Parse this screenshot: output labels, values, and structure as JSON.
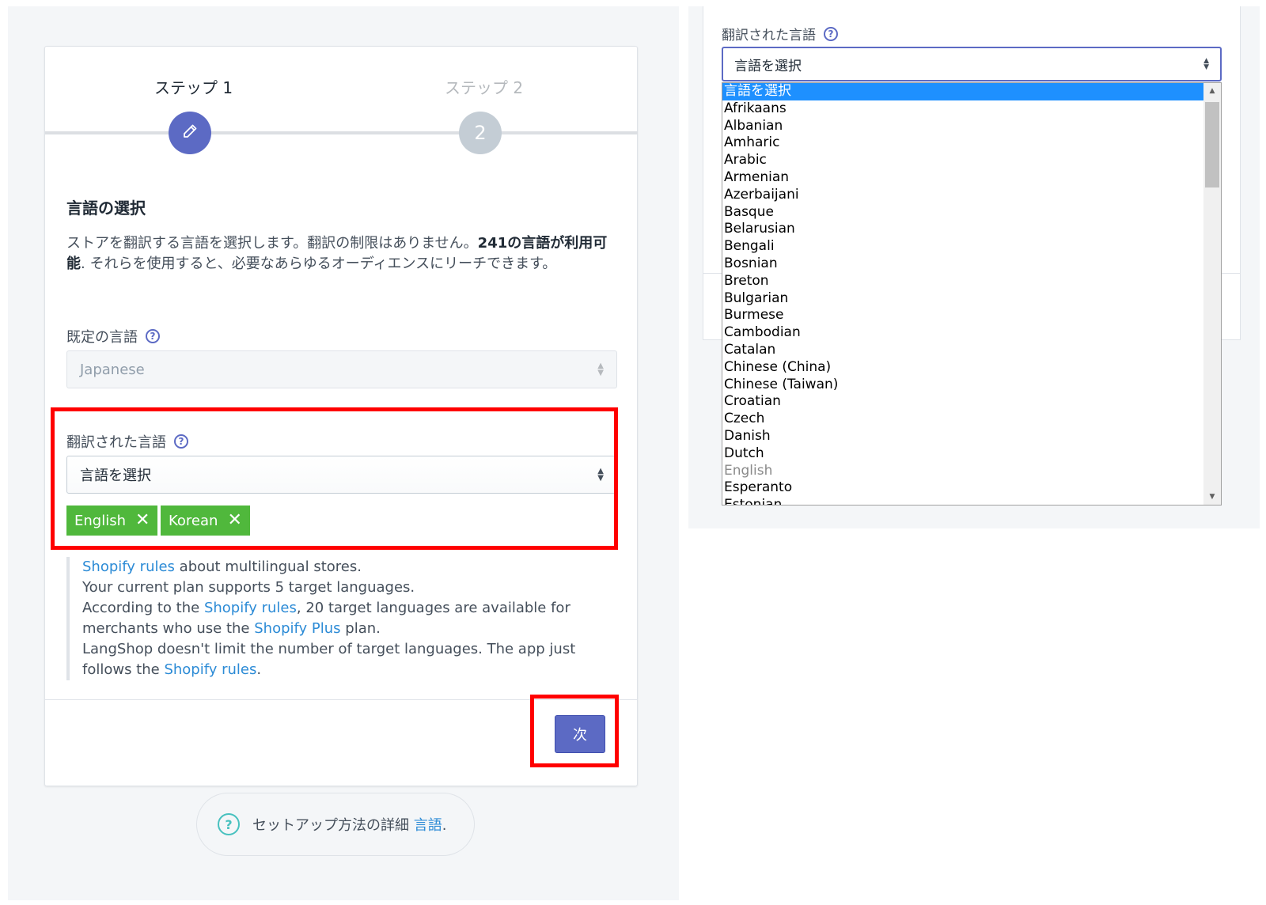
{
  "steps": [
    {
      "label": "ステップ 1",
      "state": "active",
      "icon": "pencil-icon"
    },
    {
      "label": "ステップ 2",
      "state": "inactive",
      "number": "2"
    }
  ],
  "section": {
    "title": "言語の選択",
    "desc_pre": "ストアを翻訳する言語を選択します。翻訳の制限はありません。",
    "desc_bold": "241の言語が利用可能",
    "desc_post": ". それらを使用すると、必要なあらゆるオーディエンスにリーチできます。"
  },
  "default_language": {
    "label": "既定の言語",
    "value": "Japanese"
  },
  "translated_language": {
    "label": "翻訳された言語",
    "placeholder": "言語を選択",
    "tags": [
      "English",
      "Korean"
    ]
  },
  "notes": {
    "line1_link": "Shopify rules",
    "line1_text": " about multilingual stores.",
    "line2": "Your current plan supports 5 target languages.",
    "line3_pre": "According to the ",
    "line3_link": "Shopify rules",
    "line3_mid": ", 20 target languages are available for merchants who use the ",
    "line3_link2": "Shopify Plus",
    "line3_post": " plan.",
    "line4_pre": "LangShop doesn't limit the number of target languages. The app just follows the ",
    "line4_link": "Shopify rules",
    "line4_post": "."
  },
  "next_button": "次",
  "footer_help": {
    "text": "セットアップ方法の詳細 ",
    "link": "言語",
    "post": "."
  },
  "dropdown": {
    "label": "翻訳された言語",
    "placeholder": "言語を選択",
    "options": [
      "言語を選択",
      "Afrikaans",
      "Albanian",
      "Amharic",
      "Arabic",
      "Armenian",
      "Azerbaijani",
      "Basque",
      "Belarusian",
      "Bengali",
      "Bosnian",
      "Breton",
      "Bulgarian",
      "Burmese",
      "Cambodian",
      "Catalan",
      "Chinese (China)",
      "Chinese (Taiwan)",
      "Croatian",
      "Czech",
      "Danish",
      "Dutch",
      "English",
      "Esperanto",
      "Estonian"
    ],
    "selected_index": 0,
    "disabled_index": 22
  },
  "colors": {
    "accent": "#5c6ac4",
    "tag": "#50b83c",
    "highlight": "#ff0000",
    "link": "#2c8bd6",
    "dropdown_selected": "#1e90ff"
  }
}
